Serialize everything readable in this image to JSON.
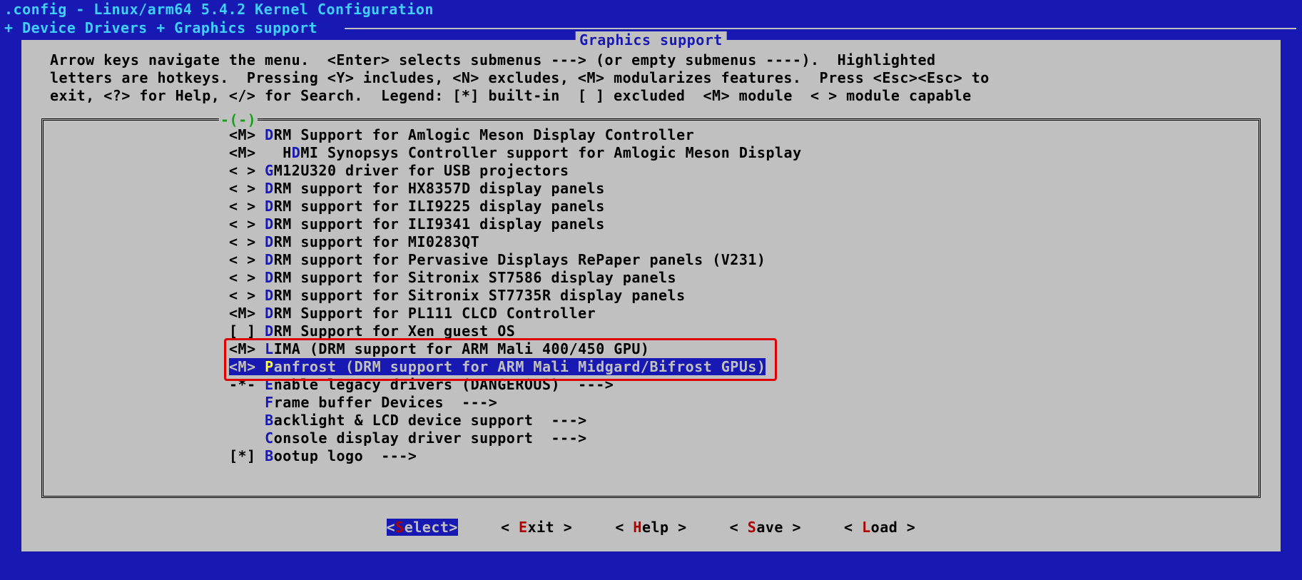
{
  "title": ".config - Linux/arm64 5.4.2 Kernel Configuration",
  "breadcrumb": "+ Device Drivers + Graphics support ",
  "section_title": "Graphics support",
  "help_text": "Arrow keys navigate the menu.  <Enter> selects submenus ---> (or empty submenus ----).  Highlighted\nletters are hotkeys.  Pressing <Y> includes, <N> excludes, <M> modularizes features.  Press <Esc><Esc> to\nexit, <?> for Help, </> for Search.  Legend: [*] built-in  [ ] excluded  <M> module  < > module capable",
  "scroll_indicator": "-(-)",
  "menu_items": [
    {
      "bracket": "<M> ",
      "pre": "",
      "hot": "D",
      "rest": "RM Support for Amlogic Meson Display Controller"
    },
    {
      "bracket": "<M>   ",
      "pre": "H",
      "hot": "D",
      "rest": "MI Synopsys Controller support for Amlogic Meson Display"
    },
    {
      "bracket": "< > ",
      "pre": "",
      "hot": "G",
      "rest": "M12U320 driver for USB projectors"
    },
    {
      "bracket": "< > ",
      "pre": "",
      "hot": "D",
      "rest": "RM support for HX8357D display panels"
    },
    {
      "bracket": "< > ",
      "pre": "",
      "hot": "D",
      "rest": "RM support for ILI9225 display panels"
    },
    {
      "bracket": "< > ",
      "pre": "",
      "hot": "D",
      "rest": "RM support for ILI9341 display panels"
    },
    {
      "bracket": "< > ",
      "pre": "",
      "hot": "D",
      "rest": "RM support for MI0283QT"
    },
    {
      "bracket": "< > ",
      "pre": "",
      "hot": "D",
      "rest": "RM support for Pervasive Displays RePaper panels (V231)"
    },
    {
      "bracket": "< > ",
      "pre": "",
      "hot": "D",
      "rest": "RM support for Sitronix ST7586 display panels"
    },
    {
      "bracket": "< > ",
      "pre": "",
      "hot": "D",
      "rest": "RM support for Sitronix ST7735R display panels"
    },
    {
      "bracket": "<M> ",
      "pre": "",
      "hot": "D",
      "rest": "RM Support for PL111 CLCD Controller"
    },
    {
      "bracket": "[ ] ",
      "pre": "",
      "hot": "D",
      "rest": "RM Support for Xen guest OS"
    },
    {
      "bracket": "<M> ",
      "pre": "",
      "hot": "L",
      "rest": "IMA (DRM support for ARM Mali 400/450 GPU)",
      "boxed": true
    },
    {
      "bracket": "<M> ",
      "pre": "",
      "hot": "P",
      "rest": "anfrost (DRM support for ARM Mali Midgard/Bifrost GPUs)",
      "boxed": true,
      "selected": true
    },
    {
      "bracket": "-*- ",
      "pre": "",
      "hot": "E",
      "rest": "nable legacy drivers (DANGEROUS)  --->"
    },
    {
      "bracket": "    ",
      "pre": "",
      "hot": "F",
      "rest": "rame buffer Devices  --->"
    },
    {
      "bracket": "    ",
      "pre": "",
      "hot": "B",
      "rest": "acklight & LCD device support  --->"
    },
    {
      "bracket": "    ",
      "pre": "",
      "hot": "C",
      "rest": "onsole display driver support  --->"
    },
    {
      "bracket": "[*] ",
      "pre": "",
      "hot": "B",
      "rest": "ootup logo  --->"
    }
  ],
  "buttons": {
    "select": {
      "left": "<",
      "hot": "S",
      "rest": "elect>",
      "active": true
    },
    "exit": {
      "left": "< ",
      "hot": "E",
      "rest": "xit >"
    },
    "help": {
      "left": "< ",
      "hot": "H",
      "rest": "elp >"
    },
    "save": {
      "left": "< ",
      "hot": "S",
      "rest": "ave >"
    },
    "load": {
      "left": "< ",
      "hot": "L",
      "rest": "oad >"
    }
  }
}
